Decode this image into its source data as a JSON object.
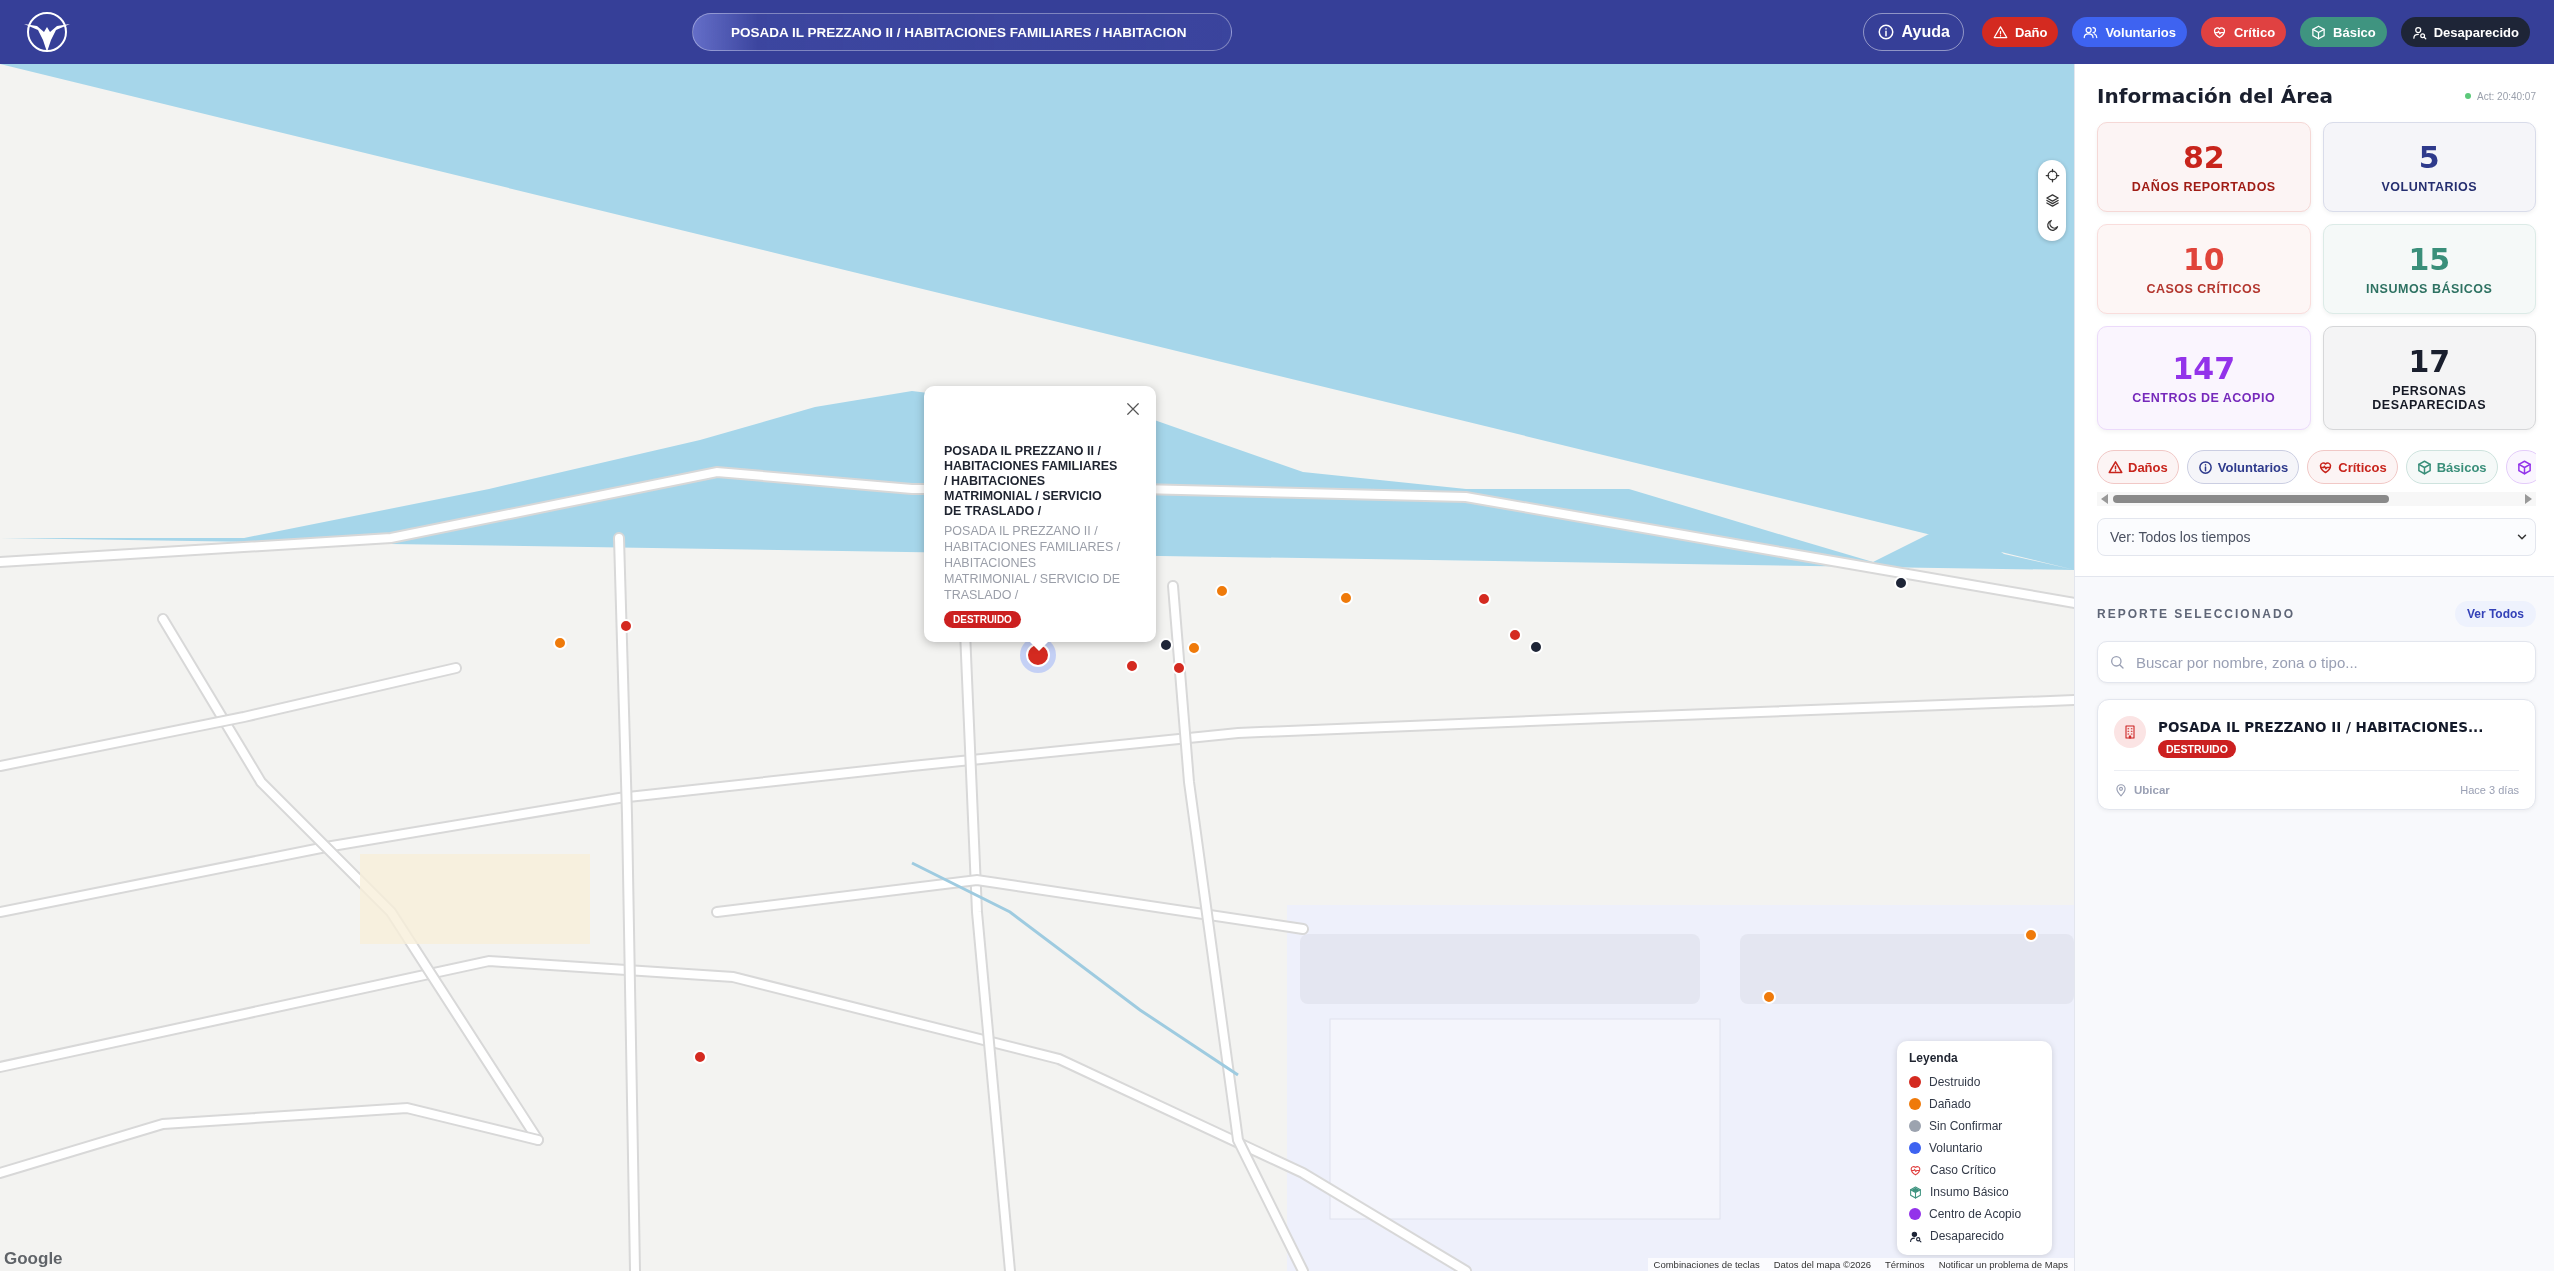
{
  "header": {
    "search_value": "POSADA IL PREZZANO II / HABITACIONES FAMILIARES / HABITACION",
    "buttons": [
      {
        "label": "Ayuda",
        "kind": "help"
      },
      {
        "label": "Daño",
        "kind": "damage",
        "color": "#d42a20"
      },
      {
        "label": "Voluntarios",
        "kind": "volunteers",
        "color": "#3e63f1"
      },
      {
        "label": "Crítico",
        "kind": "critical",
        "color": "#e04141"
      },
      {
        "label": "Básico",
        "kind": "basic",
        "color": "#3f9480"
      },
      {
        "label": "Desaparecido",
        "kind": "missing",
        "color": "#1e2537"
      }
    ]
  },
  "map": {
    "popup": {
      "title": "POSADA IL PREZZANO II / HABITACIONES FAMILIARES / HABITACIONES MATRIMONIAL / SERVICIO DE TRASLADO /",
      "subtitle": "POSADA IL PREZZANO II / HABITACIONES FAMILIARES / HABITACIONES MATRIMONIAL / SERVICIO DE TRASLADO /",
      "status": "DESTRUIDO"
    },
    "legend": {
      "title": "Leyenda",
      "items": [
        {
          "label": "Destruido",
          "kind": "dot",
          "color": "#d42a20"
        },
        {
          "label": "Dañado",
          "kind": "dot",
          "color": "#ef7a0a"
        },
        {
          "label": "Sin Confirmar",
          "kind": "dot",
          "color": "#9ca3af"
        },
        {
          "label": "Voluntario",
          "kind": "dot",
          "color": "#3e63f1"
        },
        {
          "label": "Caso Crítico",
          "kind": "heart",
          "color": "#e04141"
        },
        {
          "label": "Insumo Básico",
          "kind": "box",
          "color": "#3f9480"
        },
        {
          "label": "Centro de Acopio",
          "kind": "dot",
          "color": "#9333ea"
        },
        {
          "label": "Desaparecido",
          "kind": "person",
          "color": "#1e2537"
        }
      ]
    },
    "logo": "Google",
    "attribution": [
      "Combinaciones de teclas",
      "Datos del mapa ©2026",
      "Términos",
      "Notificar un problema de Maps"
    ]
  },
  "panel": {
    "title": "Información del Área",
    "updated": "Act: 20:40:07",
    "stats": [
      {
        "value": "82",
        "label": "DAÑOS REPORTADOS",
        "color": "#c8241c"
      },
      {
        "value": "5",
        "label": "VOLUNTARIOS",
        "color": "#2e3a8c"
      },
      {
        "value": "10",
        "label": "CASOS CRÍTICOS",
        "color": "#e0443a"
      },
      {
        "value": "15",
        "label": "INSUMOS BÁSICOS",
        "color": "#3a8f7a"
      },
      {
        "value": "147",
        "label": "CENTROS DE ACOPIO",
        "color": "#9333ea"
      },
      {
        "value": "17",
        "label": "PERSONAS DESAPARECIDAS",
        "color": "#1a1f2e"
      }
    ],
    "filters": [
      {
        "label": "Daños",
        "kind": "damage",
        "color": "#c8241c"
      },
      {
        "label": "Voluntarios",
        "kind": "volunteers",
        "color": "#2e3a8c"
      },
      {
        "label": "Críticos",
        "kind": "critical",
        "color": "#c8241c"
      },
      {
        "label": "Básicos",
        "kind": "basic",
        "color": "#3a8f7a"
      },
      {
        "kind": "centers",
        "color": "#9333ea"
      }
    ],
    "time_filter": "Ver: Todos los tiempos",
    "section_title": "REPORTE SELECCIONADO",
    "view_all": "Ver Todos",
    "search_placeholder": "Buscar por nombre, zona o tipo...",
    "report": {
      "title": "POSADA IL PREZZANO II / HABITACIONES...",
      "status": "DESTRUIDO",
      "locate": "Ubicar",
      "time": "Hace 3 días"
    }
  }
}
